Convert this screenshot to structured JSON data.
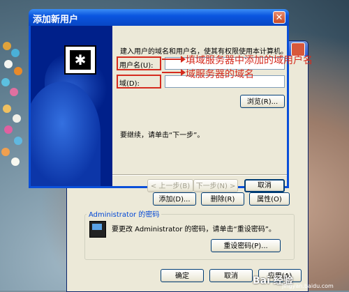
{
  "dialog": {
    "title": "添加新用户",
    "close_glyph": "✕",
    "description": "建入用户的域名和用户名，使其有权限使用本计算机。",
    "username_label": "用户名(U):",
    "domain_label": "域(D):",
    "browse_button": "浏览(R)...",
    "continue_text": "要继续，请单击“下一步”。",
    "back_button": "< 上一步(B)",
    "next_button": "下一步(N) >",
    "cancel_button": "取消",
    "icon": "add-user-icon"
  },
  "annotations": {
    "username_note": "填域服务器中添加的域用户名",
    "domain_note": "域服务器的域名",
    "color": "#d52b1e"
  },
  "parent_window": {
    "add_button": "添加(D)...",
    "delete_button": "删除(R)",
    "properties_button": "属性(O)",
    "password_group_label": "Administrator 的密码",
    "password_text": "要更改 Administrator 的密码，请单击“重设密码”。",
    "reset_password_button": "重设密码(P)...",
    "ok_button": "确定",
    "cancel_button": "取消",
    "apply_button": "应用(A)"
  },
  "watermark": {
    "main": "Bai 经验",
    "sub": "jingyan.baidu.com"
  },
  "colors": {
    "titlebar": "#0a55e0",
    "dialog_bg": "#ece9d8",
    "banner": "#00208a"
  }
}
